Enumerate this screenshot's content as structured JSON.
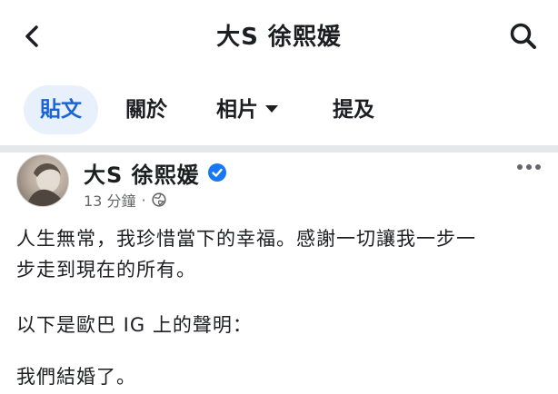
{
  "header": {
    "title": "大S 徐熙媛",
    "back_icon": "chevron-left-icon",
    "search_icon": "search-icon"
  },
  "tabs": [
    {
      "label": "貼文",
      "active": true
    },
    {
      "label": "關於",
      "active": false
    },
    {
      "label": "相片",
      "active": false,
      "dropdown": true
    },
    {
      "label": "提及",
      "active": false
    }
  ],
  "post": {
    "author": "大S 徐熙媛",
    "verified": true,
    "timestamp": "13 分鐘",
    "separator": "·",
    "audience_icon": "globe-icon",
    "more_icon": "more-dots-icon",
    "lines": [
      "人生無常，我珍惜當下的幸福。感謝一切讓我一步一",
      "步走到現在的所有。",
      "以下是歐巴 IG 上的聲明：",
      "我們結婚了。"
    ]
  },
  "colors": {
    "accent": "#1b64d6",
    "active_tab_bg": "#e7f0fb",
    "verified_badge": "#1877f2",
    "secondary_text": "#65676b",
    "divider": "#e6e7ea"
  }
}
